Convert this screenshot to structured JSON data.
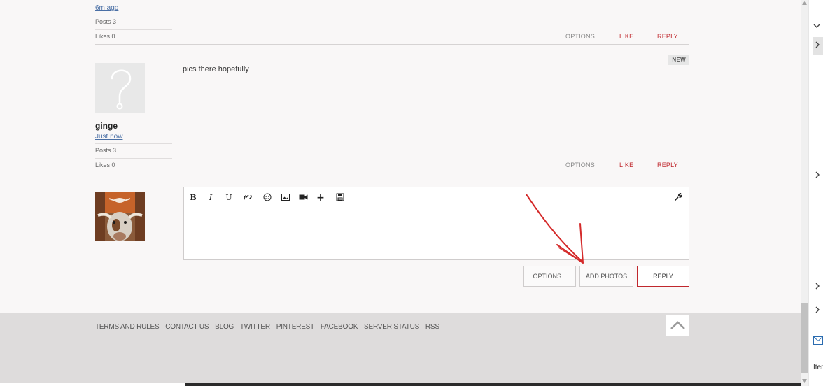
{
  "prev_post": {
    "time": "6m ago",
    "posts": "Posts 3",
    "likes": "Likes 0",
    "actions": {
      "options": "OPTIONS",
      "like": "LIKE",
      "reply": "REPLY"
    }
  },
  "post": {
    "author": "ginge",
    "time": "Just now",
    "posts": "Posts 3",
    "likes": "Likes 0",
    "body": "pics there hopefully",
    "badge": "NEW",
    "actions": {
      "options": "OPTIONS",
      "like": "LIKE",
      "reply": "REPLY"
    }
  },
  "editor": {
    "toolbar": [
      "bold-icon",
      "italic-icon",
      "underline-icon",
      "link-icon",
      "smiley-icon",
      "image-icon",
      "video-icon",
      "plus-icon",
      "save-icon",
      "wrench-icon"
    ],
    "bold": "B",
    "italic": "I",
    "underline": "U"
  },
  "buttons": {
    "options": "OPTIONS...",
    "add_photos": "ADD PHOTOS",
    "reply": "REPLY"
  },
  "footer": {
    "links": [
      "TERMS AND RULES",
      "CONTACT US",
      "BLOG",
      "TWITTER",
      "PINTEREST",
      "FACEBOOK",
      "SERVER STATUS",
      "RSS"
    ]
  },
  "side_panel": {
    "label": "Iter"
  },
  "colors": {
    "accent": "#c0272d",
    "footer_bg": "#dedcdc",
    "annotation_arrow": "#d42a2a"
  }
}
